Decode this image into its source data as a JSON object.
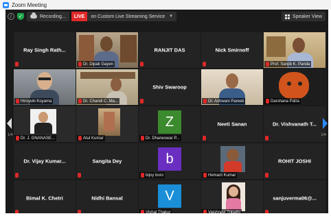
{
  "window_title": "Zoom Meeting",
  "topbar": {
    "recording_label": "Recording...",
    "live_label": "LIVE",
    "live_service": "on Custom Live Streaming Service",
    "speaker_view": "Speaker View"
  },
  "pagination": {
    "left": "1/4",
    "right": "1/4"
  },
  "participants": [
    {
      "name": "Ray Singh Rath...",
      "type": "name"
    },
    {
      "name": "Dr. Dipak Gayen",
      "type": "video"
    },
    {
      "name": "RANJIT DAS",
      "type": "name"
    },
    {
      "name": "Nick Smirnoff",
      "type": "name"
    },
    {
      "name": "Prof. Sanjib K. Panda",
      "type": "video"
    },
    {
      "name": "Hiroyuki Koyama",
      "type": "video"
    },
    {
      "name": "Dr. Chandi C. Ma...",
      "type": "video"
    },
    {
      "name": "Shiv Swaroop",
      "type": "name"
    },
    {
      "name": "Dr. Ashwani Pareek",
      "type": "video"
    },
    {
      "name": "Darshana Patra",
      "type": "video"
    },
    {
      "name": "Dr. J. GNANASE...",
      "type": "video"
    },
    {
      "name": "Atul Kumar",
      "type": "video"
    },
    {
      "name": "Dr. Dhaneswar P...",
      "type": "avatar",
      "letter": "Z",
      "color": "#3c8a2e"
    },
    {
      "name": "Neeti Sanan",
      "type": "name"
    },
    {
      "name": "Dr. Vishvanath T...",
      "type": "name"
    },
    {
      "name": "Dr. Vijay Kumar...",
      "type": "name"
    },
    {
      "name": "Sangita Dey",
      "type": "name"
    },
    {
      "name": "bijoy boro",
      "type": "avatar",
      "letter": "b",
      "color": "#6a2fc0"
    },
    {
      "name": "Hemant Kumar",
      "type": "video"
    },
    {
      "name": "ROHIT JOSHI",
      "type": "name"
    },
    {
      "name": "Bimal K. Chetri",
      "type": "name"
    },
    {
      "name": "Nidhi Bansal",
      "type": "name"
    },
    {
      "name": "Vishal Thakur",
      "type": "avatar",
      "letter": "V",
      "color": "#1a8fd8"
    },
    {
      "name": "Vaishnavi Tripathi",
      "type": "video"
    },
    {
      "name": "sanjuverma06@...",
      "type": "name"
    }
  ]
}
